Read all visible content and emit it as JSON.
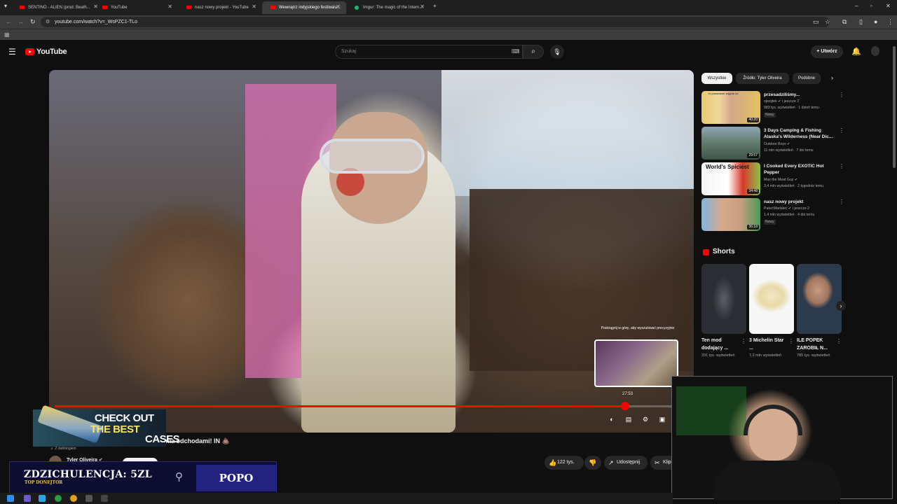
{
  "browser": {
    "tabs": [
      {
        "title": "SENTINO - ALIEN (prod. Beath...",
        "icon": "youtube-icon",
        "active": false
      },
      {
        "title": "YouTube",
        "icon": "youtube-icon",
        "active": false
      },
      {
        "title": "nasz nowy projekt - YouTube",
        "icon": "youtube-icon",
        "active": false
      },
      {
        "title": "Wewnątrz indyjskiego festiwalu...",
        "icon": "youtube-icon",
        "active": true
      },
      {
        "title": "Imgur: The magic of the Intern...",
        "icon": "imgur-icon",
        "active": false
      }
    ],
    "url": "youtube.com/watch?v=_WsPZC1-TLo"
  },
  "header": {
    "logo_text": "YouTube",
    "search_placeholder": "Szukaj",
    "create_label": "Utwórz"
  },
  "player": {
    "progress_fraction": 0.9,
    "preview_hint": "Podciągnij w górę, aby wyszukiwać precyzyjnie",
    "preview_time": "27:53",
    "colors": {
      "progress": "#ff0000"
    }
  },
  "video_info": {
    "dub_label": "Z dubbingiem",
    "title": "nia odchodami! IN",
    "channel": "Tyler Oliveira",
    "likes": "122 tys.",
    "share_label": "Udostępnij",
    "clip_label": "Klip"
  },
  "chips": [
    "Wszystkie",
    "Źródło: Tyler Oliveira",
    "Podobne"
  ],
  "recommendations": [
    {
      "title": "przesadziliśmy...",
      "channel": "ojwojtek",
      "channel_extra": "i jeszcze 2",
      "meta": "983 tys. wyświetleń · 1 dzień temu",
      "badge": "Nowy",
      "duration": "40:20"
    },
    {
      "title": "3 Days Camping & Fishing Alaska's Wilderness (Near Dic...",
      "channel": "Outdoor Boys",
      "channel_extra": "",
      "meta": "11 mln wyświetleń · 7 dni temu",
      "badge": "",
      "duration": "29:57"
    },
    {
      "title": "I Cooked Every EXOTIC Hot Pepper",
      "channel": "Max the Meat Guy",
      "channel_extra": "",
      "meta": "3,4 mln wyświetleń · 2 tygodnie temu",
      "badge": "",
      "duration": "34:48"
    },
    {
      "title": "nasz nowy projekt",
      "channel": "PatecWariatec",
      "channel_extra": "i jeszcze 2",
      "meta": "1,4 mln wyświetleń · 4 dni temu",
      "badge": "Nowy",
      "duration": "36:18"
    }
  ],
  "rec_thumb_texts": {
    "r0": "to prawdziwe zdjęcia od",
    "r2": "World's Spiciest"
  },
  "shorts": {
    "heading": "Shorts",
    "items": [
      {
        "title": "Ten mod dodający ...",
        "views": "331 tys. wyświetleń"
      },
      {
        "title": "3 Michelin Star ...",
        "views": "7,2 mln wyświetleń"
      },
      {
        "title": "ILE POPEK ZAROBIŁ N...",
        "views": "785 tys. wyświetleń"
      }
    ]
  },
  "overlay": {
    "cases_line1": "CHECK OUT",
    "cases_line2": "THE BEST",
    "cases_line3": "CASES",
    "donation_text": "ZDZICHULENCJA: 5ZL",
    "donation_sub": "TOP DONEJTOR",
    "donor_name": "POPO"
  }
}
